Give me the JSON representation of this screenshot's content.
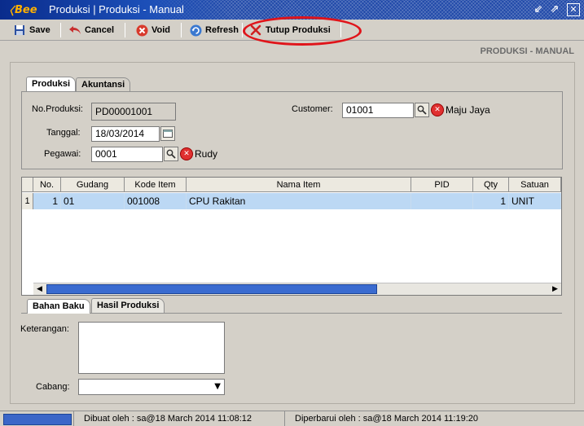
{
  "window": {
    "title": "Produksi | Produksi - Manual",
    "logo_text": "Bee"
  },
  "toolbar": {
    "save": "Save",
    "cancel": "Cancel",
    "void": "Void",
    "refresh": "Refresh",
    "close_prod": "Tutup Produksi"
  },
  "page_heading": "PRODUKSI - MANUAL",
  "tabs_top": [
    "Produksi",
    "Akuntansi"
  ],
  "form": {
    "no_produksi_label": "No.Produksi:",
    "no_produksi_value": "PD00001001",
    "tanggal_label": "Tanggal:",
    "tanggal_value": "18/03/2014",
    "pegawai_label": "Pegawai:",
    "pegawai_value": "0001",
    "pegawai_name": "Rudy",
    "customer_label": "Customer:",
    "customer_value": "01001",
    "customer_name": "Maju Jaya"
  },
  "grid": {
    "columns": [
      "No.",
      "Gudang",
      "Kode Item",
      "Nama Item",
      "PID",
      "Qty",
      "Satuan"
    ],
    "rows": [
      {
        "rownum": "1",
        "no": "1",
        "gudang": "01",
        "kode": "001008",
        "nama": "CPU Rakitan",
        "pid": "",
        "qty": "1",
        "satuan": "UNIT"
      }
    ]
  },
  "tabs_bottom": [
    "Bahan Baku",
    "Hasil Produksi"
  ],
  "bottom_form": {
    "keterangan_label": "Keterangan:",
    "keterangan_value": "",
    "cabang_label": "Cabang:",
    "cabang_value": ""
  },
  "status": {
    "created": "Dibuat oleh : sa@18 March 2014  11:08:12",
    "updated": "Diperbarui oleh : sa@18 March 2014  11:19:20"
  },
  "colors": {
    "titlebar": "#1f48a8",
    "selection_row": "#bcd8f4",
    "highlight_ellipse": "#e0141a"
  }
}
